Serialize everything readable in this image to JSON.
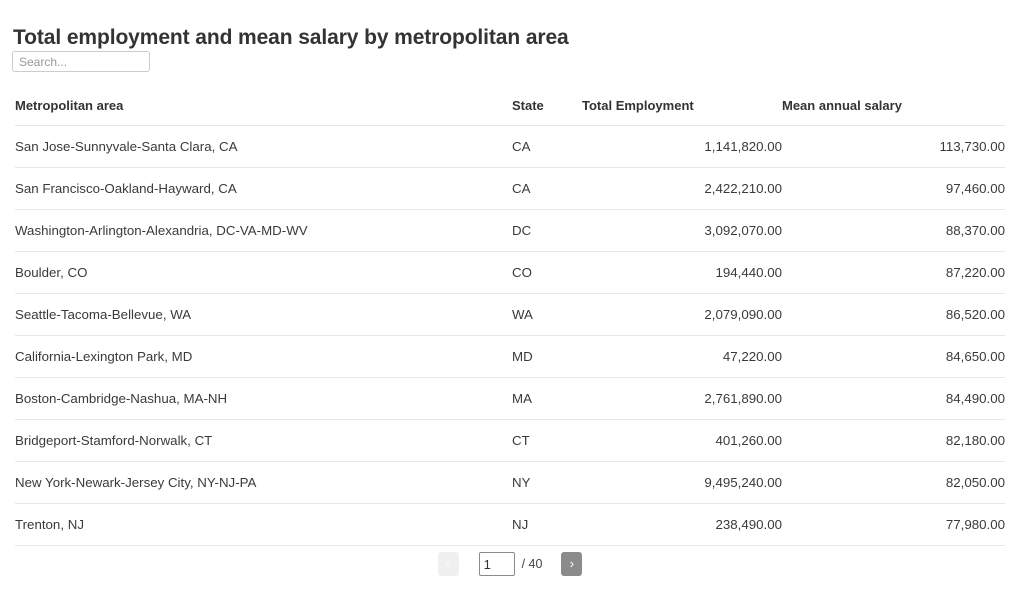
{
  "header": {
    "title": "Total employment and mean salary by metropolitan area"
  },
  "search": {
    "placeholder": "Search...",
    "value": ""
  },
  "table": {
    "columns": [
      {
        "key": "area",
        "label": "Metropolitan area",
        "align": "left"
      },
      {
        "key": "state",
        "label": "State",
        "align": "left"
      },
      {
        "key": "emp",
        "label": "Total Employment",
        "align": "right"
      },
      {
        "key": "salary",
        "label": "Mean annual salary",
        "align": "right"
      }
    ],
    "rows": [
      {
        "area": "San Jose-Sunnyvale-Santa Clara, CA",
        "state": "CA",
        "emp": "1,141,820.00",
        "salary": "113,730.00"
      },
      {
        "area": "San Francisco-Oakland-Hayward, CA",
        "state": "CA",
        "emp": "2,422,210.00",
        "salary": "97,460.00"
      },
      {
        "area": "Washington-Arlington-Alexandria, DC-VA-MD-WV",
        "state": "DC",
        "emp": "3,092,070.00",
        "salary": "88,370.00"
      },
      {
        "area": "Boulder, CO",
        "state": "CO",
        "emp": "194,440.00",
        "salary": "87,220.00"
      },
      {
        "area": "Seattle-Tacoma-Bellevue, WA",
        "state": "WA",
        "emp": "2,079,090.00",
        "salary": "86,520.00"
      },
      {
        "area": "California-Lexington Park, MD",
        "state": "MD",
        "emp": "47,220.00",
        "salary": "84,650.00"
      },
      {
        "area": "Boston-Cambridge-Nashua, MA-NH",
        "state": "MA",
        "emp": "2,761,890.00",
        "salary": "84,490.00"
      },
      {
        "area": "Bridgeport-Stamford-Norwalk, CT",
        "state": "CT",
        "emp": "401,260.00",
        "salary": "82,180.00"
      },
      {
        "area": "New York-Newark-Jersey City, NY-NJ-PA",
        "state": "NY",
        "emp": "9,495,240.00",
        "salary": "82,050.00"
      },
      {
        "area": "Trenton, NJ",
        "state": "NJ",
        "emp": "238,490.00",
        "salary": "77,980.00"
      }
    ]
  },
  "pagination": {
    "prev_label": "‹",
    "next_label": "›",
    "current_page": "1",
    "total_pages_label": "/ 40",
    "total_pages": 40
  },
  "colors": {
    "text": "#333333",
    "row_border": "#e8e8e8",
    "header_border": "#e4e4e4",
    "input_border": "#cccccc",
    "next_button_bg": "#8b8b8b",
    "prev_button_bg": "#f0f0f0",
    "placeholder": "#999999"
  }
}
